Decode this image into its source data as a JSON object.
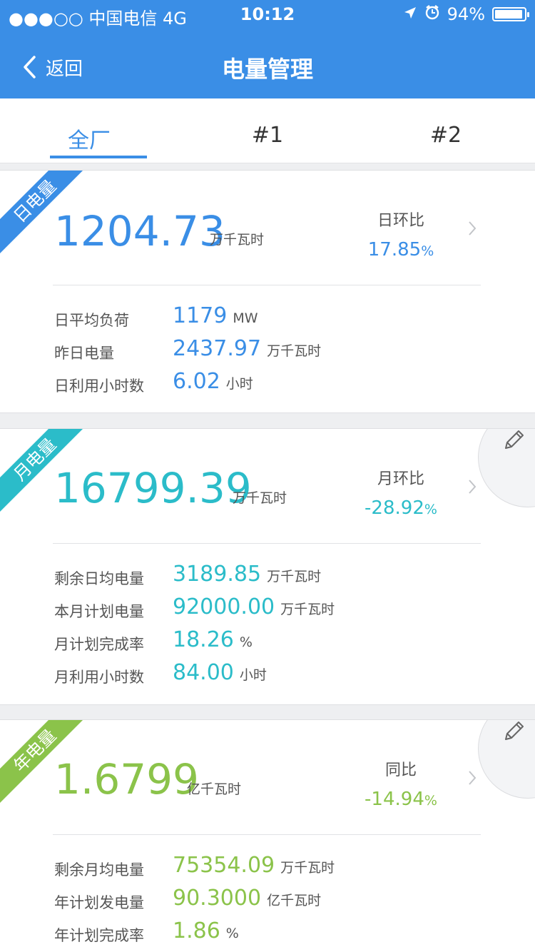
{
  "status_bar": {
    "carrier": "●●●○○ 中国电信  4G",
    "time": "10:12",
    "battery": "94%"
  },
  "header": {
    "back_label": "返回",
    "title": "电量管理"
  },
  "tabs": [
    {
      "label": "全厂",
      "active": true
    },
    {
      "label": "#1",
      "active": false
    },
    {
      "label": "#2",
      "active": false
    }
  ],
  "colors": {
    "header": "#3a8ee6",
    "day": "#3a8ee6",
    "month": "#2bbcc9",
    "year": "#8bc34a"
  },
  "day_card": {
    "ribbon": "日电量",
    "value": "1204.73",
    "unit": "万千瓦时",
    "ratio_label": "日环比",
    "ratio_value": "17.85",
    "ratio_pct": "%",
    "rows": [
      {
        "label": "日平均负荷",
        "value": "1179",
        "unit": "MW"
      },
      {
        "label": "昨日电量",
        "value": "2437.97",
        "unit": "万千瓦时"
      },
      {
        "label": "日利用小时数",
        "value": "6.02",
        "unit": "小时"
      }
    ]
  },
  "month_card": {
    "ribbon": "月电量",
    "value": "16799.39",
    "unit": "万千瓦时",
    "ratio_label": "月环比",
    "ratio_value": "-28.92",
    "ratio_pct": "%",
    "rows": [
      {
        "label": "剩余日均电量",
        "value": "3189.85",
        "unit": "万千瓦时"
      },
      {
        "label": "本月计划电量",
        "value": "92000.00",
        "unit": "万千瓦时"
      },
      {
        "label": "月计划完成率",
        "value": "18.26",
        "unit": "%"
      },
      {
        "label": "月利用小时数",
        "value": "84.00",
        "unit": "小时"
      }
    ]
  },
  "year_card": {
    "ribbon": "年电量",
    "value": "1.6799",
    "unit": "亿千瓦时",
    "ratio_label": "同比",
    "ratio_value": "-14.94",
    "ratio_pct": "%",
    "rows": [
      {
        "label": "剩余月均电量",
        "value": "75354.09",
        "unit": "万千瓦时"
      },
      {
        "label": "年计划发电量",
        "value": "90.3000",
        "unit": "亿千瓦时"
      },
      {
        "label": "年计划完成率",
        "value": "1.86",
        "unit": "%"
      }
    ]
  }
}
